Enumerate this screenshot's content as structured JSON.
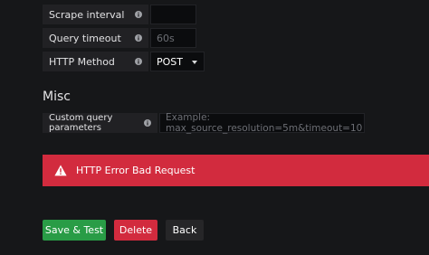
{
  "fields": [
    {
      "label": "Scrape interval",
      "value": "",
      "placeholder": ""
    },
    {
      "label": "Query timeout",
      "value": "",
      "placeholder": "60s"
    },
    {
      "label": "HTTP Method",
      "value": "POST"
    }
  ],
  "misc": {
    "title": "Misc",
    "custom_params_label": "Custom query parameters",
    "custom_params_placeholder": "Example: max_source_resolution=5m&timeout=10"
  },
  "alert": {
    "message": "HTTP Error Bad Request",
    "icon": "warning-icon",
    "color": "#d22b3e"
  },
  "buttons": {
    "save": "Save & Test",
    "delete": "Delete",
    "back": "Back"
  },
  "colors": {
    "save": "#299c46",
    "delete": "#d22b3e",
    "back": "#262628"
  },
  "icons": {
    "info": "info-icon",
    "dropdown": "chevron-down-icon"
  }
}
